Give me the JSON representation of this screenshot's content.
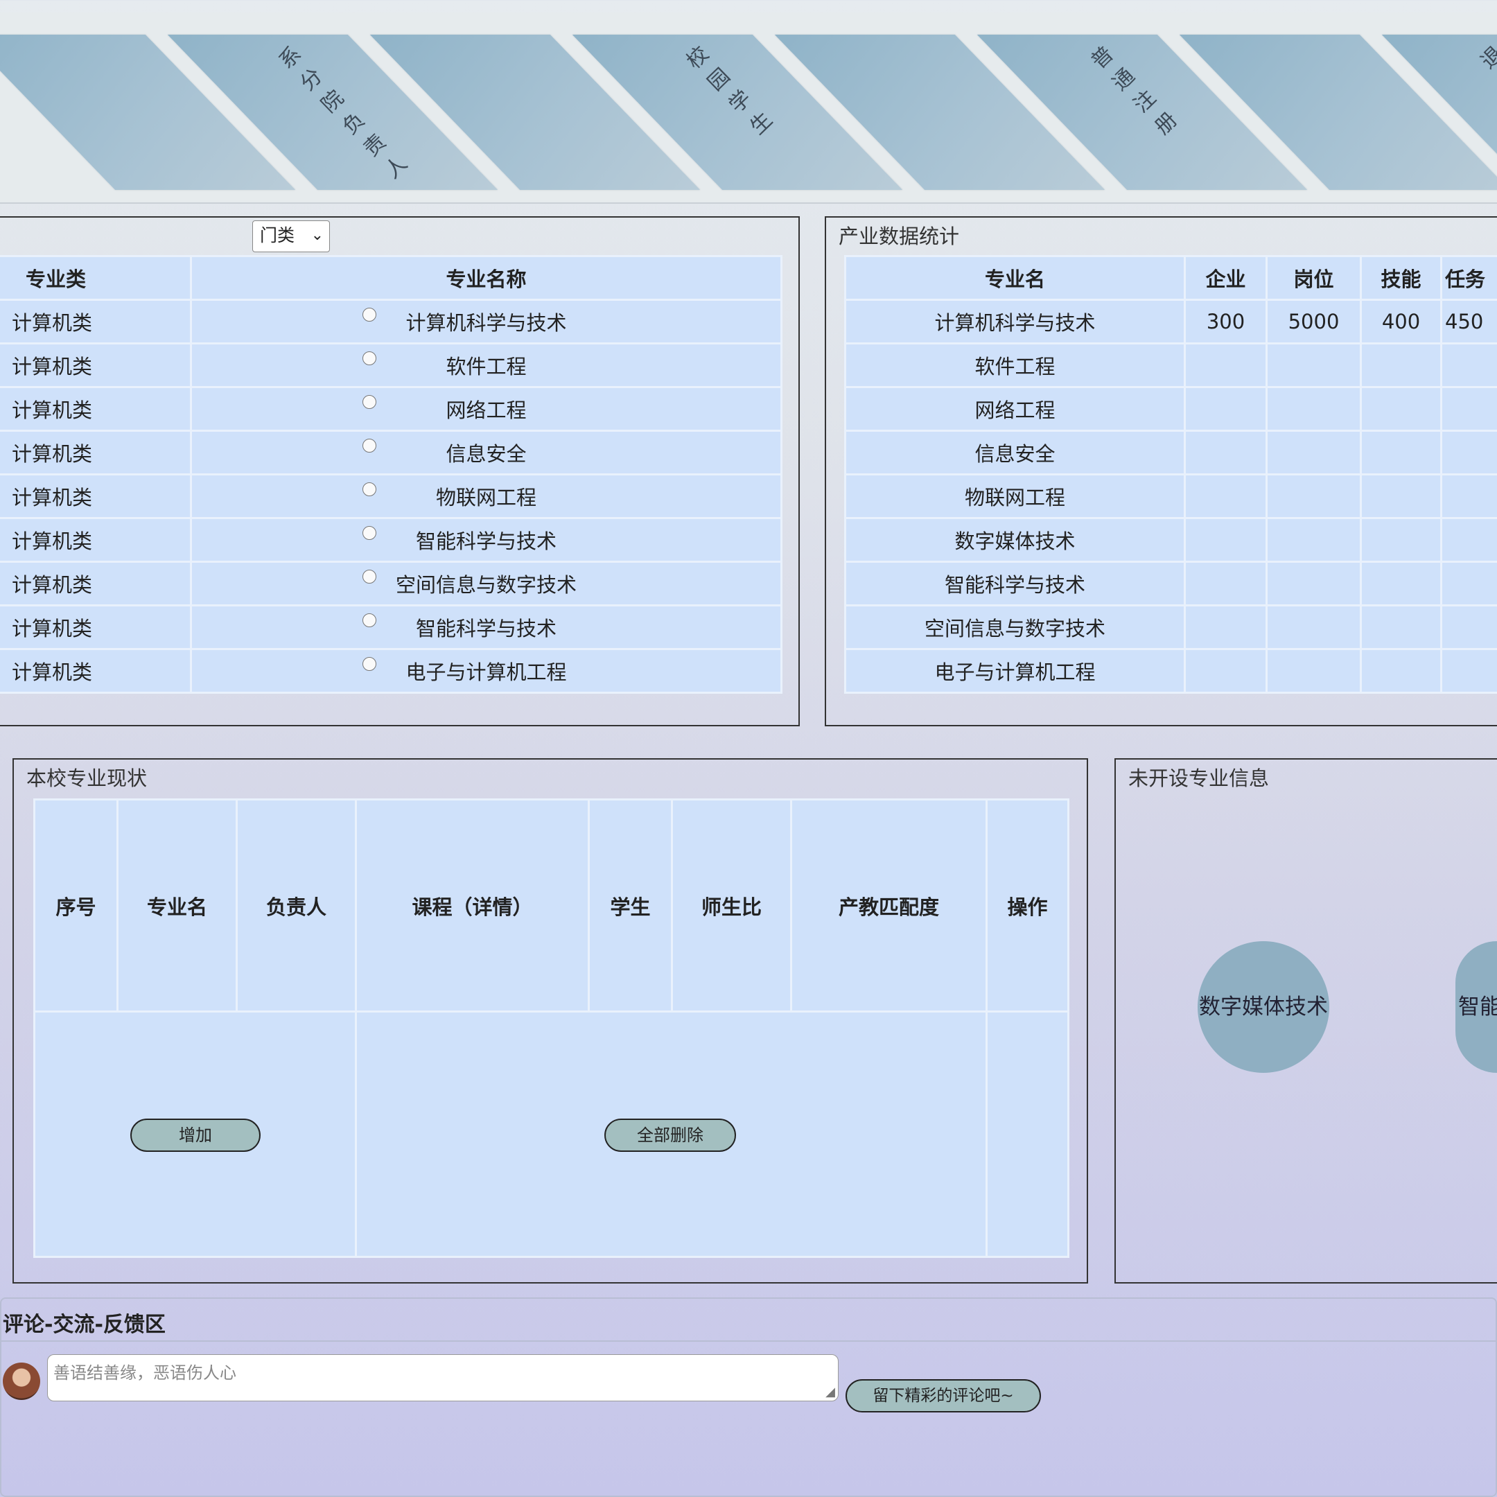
{
  "nav_tiles": [
    {
      "label": ""
    },
    {
      "label": "系分院负责人"
    },
    {
      "label": ""
    },
    {
      "label": "校园学生"
    },
    {
      "label": ""
    },
    {
      "label": "普通注册"
    },
    {
      "label": ""
    },
    {
      "label": "退"
    }
  ],
  "majors": {
    "select_value": "门类",
    "headers": {
      "category": "专业类",
      "name": "专业名称"
    },
    "rows": [
      {
        "category": "计算机类",
        "name": "计算机科学与技术"
      },
      {
        "category": "计算机类",
        "name": "软件工程"
      },
      {
        "category": "计算机类",
        "name": "网络工程"
      },
      {
        "category": "计算机类",
        "name": "信息安全"
      },
      {
        "category": "计算机类",
        "name": "物联网工程"
      },
      {
        "category": "计算机类",
        "name": "智能科学与技术"
      },
      {
        "category": "计算机类",
        "name": "空间信息与数字技术"
      },
      {
        "category": "计算机类",
        "name": "智能科学与技术"
      },
      {
        "category": "计算机类",
        "name": "电子与计算机工程"
      }
    ]
  },
  "industry": {
    "title": "产业数据统计",
    "headers": {
      "major": "专业名",
      "enterprise": "企业",
      "post": "岗位",
      "skill": "技能",
      "task": "任务"
    },
    "rows": [
      {
        "major": "计算机科学与技术",
        "enterprise": "300",
        "post": "5000",
        "skill": "400",
        "task": "450"
      },
      {
        "major": "软件工程",
        "enterprise": "",
        "post": "",
        "skill": "",
        "task": ""
      },
      {
        "major": "网络工程",
        "enterprise": "",
        "post": "",
        "skill": "",
        "task": ""
      },
      {
        "major": "信息安全",
        "enterprise": "",
        "post": "",
        "skill": "",
        "task": ""
      },
      {
        "major": "物联网工程",
        "enterprise": "",
        "post": "",
        "skill": "",
        "task": ""
      },
      {
        "major": "数字媒体技术",
        "enterprise": "",
        "post": "",
        "skill": "",
        "task": ""
      },
      {
        "major": "智能科学与技术",
        "enterprise": "",
        "post": "",
        "skill": "",
        "task": ""
      },
      {
        "major": "空间信息与数字技术",
        "enterprise": "",
        "post": "",
        "skill": "",
        "task": ""
      },
      {
        "major": "电子与计算机工程",
        "enterprise": "",
        "post": "",
        "skill": "",
        "task": ""
      }
    ]
  },
  "school": {
    "title": "本校专业现状",
    "headers": [
      "序号",
      "专业名",
      "负责人",
      "课程（详情）",
      "学生",
      "师生比",
      "产教匹配度",
      "操作"
    ],
    "add_button": "增加",
    "delete_all_button": "全部删除"
  },
  "unopened": {
    "title": "未开设专业信息",
    "bubbles": [
      "数字媒体技术",
      "智能"
    ]
  },
  "comments": {
    "title": "评论-交流-反馈区",
    "placeholder": "善语结善缘，恶语伤人心",
    "submit": "留下精彩的评论吧~"
  },
  "colors": {
    "table_cell": "#cfe1fa",
    "tile": "#a7c2d3",
    "button": "#a3bfc0",
    "bubble": "#8fafc2"
  }
}
